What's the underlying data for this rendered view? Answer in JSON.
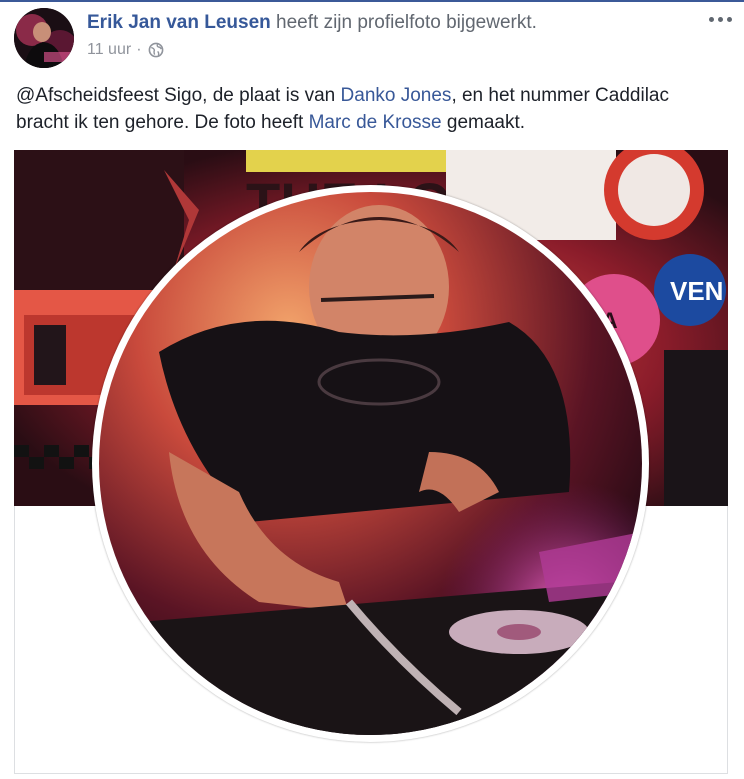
{
  "post": {
    "author": "Erik Jan van Leusen",
    "action": "heeft zijn profielfoto bijgewerkt.",
    "time": "11 uur",
    "separator": "·",
    "audience_icon": "globe-icon",
    "more_icon": "more-options-icon"
  },
  "body": {
    "part1": "@Afscheidsfeest Sigo, de plaat is van ",
    "link1": "Danko Jones",
    "part2": ", en het nummer Caddilac bracht ik ten gehore. De foto heeft ",
    "link2": "Marc de Krosse",
    "part3": " gemaakt."
  },
  "cover_photo": {
    "lettering": "THE LOOST",
    "stickers": [
      "VEN",
      "ANA"
    ]
  },
  "colors": {
    "brand": "#3b5998",
    "link": "#385898",
    "name": "#365899",
    "meta": "#90949c",
    "text": "#1d2129"
  }
}
